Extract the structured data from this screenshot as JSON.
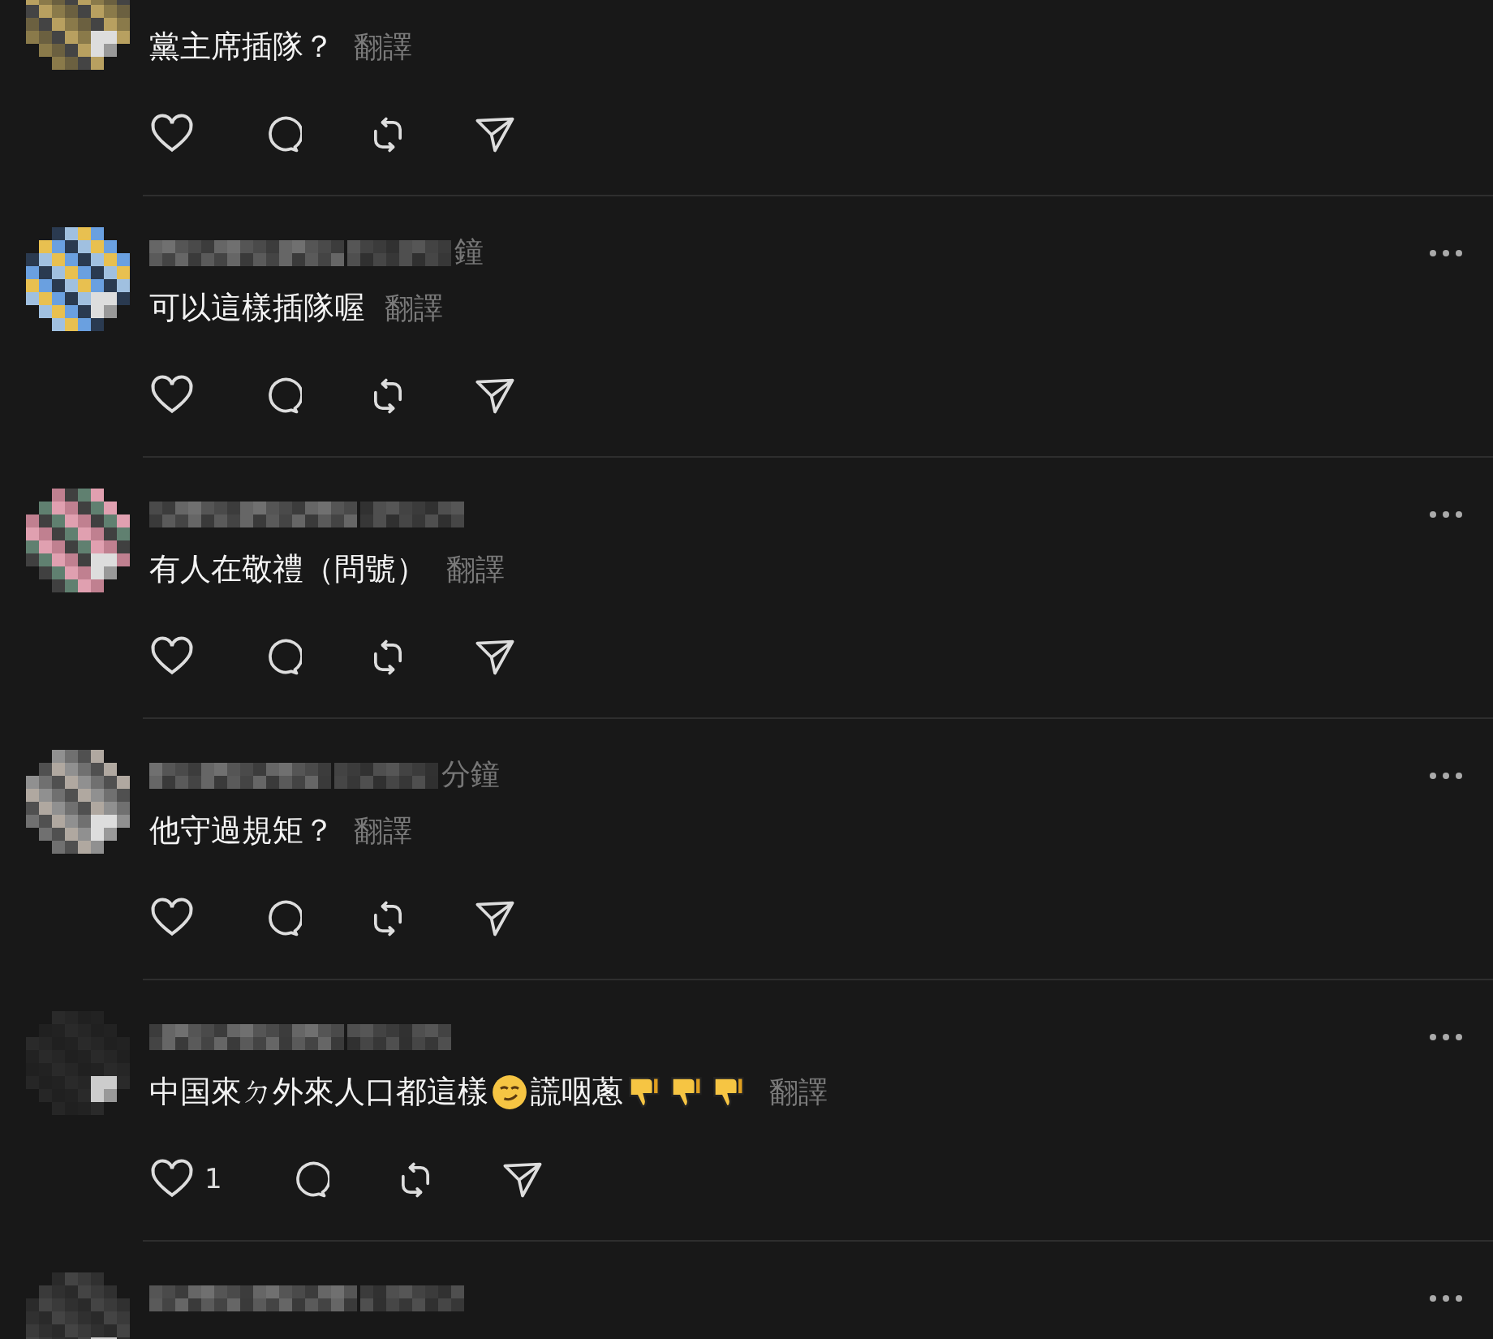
{
  "comments": [
    {
      "kind": "comment",
      "body": [
        {
          "kind": "text",
          "text": "黨主席插隊？"
        }
      ],
      "translate": "翻譯"
    },
    {
      "kind": "comment",
      "time": "鐘",
      "body": [
        {
          "kind": "text",
          "text": "可以這樣插隊喔"
        }
      ],
      "translate": "翻譯"
    },
    {
      "kind": "comment",
      "body": [
        {
          "kind": "text",
          "text": "有人在敬禮（問號）"
        }
      ],
      "translate": "翻譯"
    },
    {
      "kind": "comment",
      "time": "分鐘",
      "body": [
        {
          "kind": "text",
          "text": "他守過規矩？"
        }
      ],
      "translate": "翻譯"
    },
    {
      "kind": "comment",
      "body": [
        {
          "kind": "text",
          "text": "中国來ㄉ外來人口都這樣"
        },
        {
          "kind": "smirk"
        },
        {
          "kind": "text",
          "text": "謊咽蔥"
        },
        {
          "kind": "thumbs_down"
        },
        {
          "kind": "thumbs_down"
        },
        {
          "kind": "thumbs_down"
        }
      ],
      "translate": "翻譯",
      "likes": "1"
    },
    {
      "kind": "comment"
    }
  ]
}
